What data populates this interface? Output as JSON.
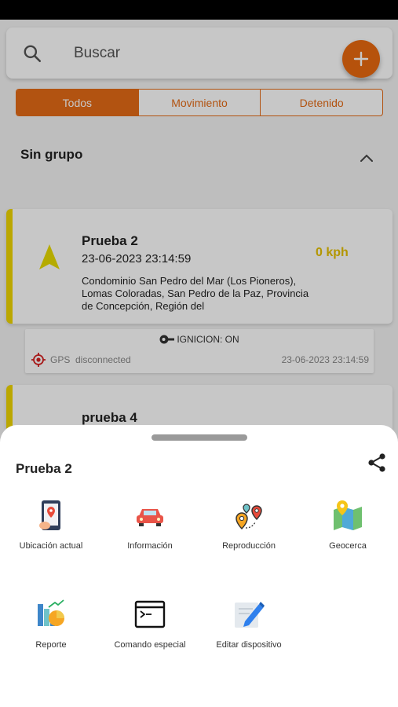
{
  "search": {
    "placeholder": "Buscar"
  },
  "filters": [
    {
      "label": "Todos",
      "active": true
    },
    {
      "label": "Movimiento",
      "active": false
    },
    {
      "label": "Detenido",
      "active": false
    }
  ],
  "group": {
    "title": "Sin grupo"
  },
  "vehicles": [
    {
      "name": "Prueba 2",
      "timestamp": "23-06-2023 23:14:59",
      "speed": "0 kph",
      "address": "Condominio San Pedro del Mar (Los Pioneros), Lomas Coloradas, San Pedro de la Paz, Provincia de Concepción, Región del",
      "ignition": "IGNICION: ON",
      "gps_label": "GPS",
      "gps_status": "disconnected",
      "gps_time": "23-06-2023 23:14:59"
    },
    {
      "name": "prueba 4"
    }
  ],
  "sheet": {
    "title": "Prueba 2",
    "actions": [
      {
        "label": "Ubicación actual",
        "icon": "current-location-icon"
      },
      {
        "label": "Información",
        "icon": "car-info-icon"
      },
      {
        "label": "Reproducción",
        "icon": "playback-route-icon"
      },
      {
        "label": "Geocerca",
        "icon": "geofence-map-icon"
      },
      {
        "label": "Reporte",
        "icon": "report-chart-icon"
      },
      {
        "label": "Comando especial",
        "icon": "terminal-command-icon"
      },
      {
        "label": "Editar dispositivo",
        "icon": "edit-device-icon"
      }
    ]
  },
  "colors": {
    "accent": "#e56b16",
    "vehicle_status": "#f0d600",
    "speed_text": "#e6c100"
  }
}
